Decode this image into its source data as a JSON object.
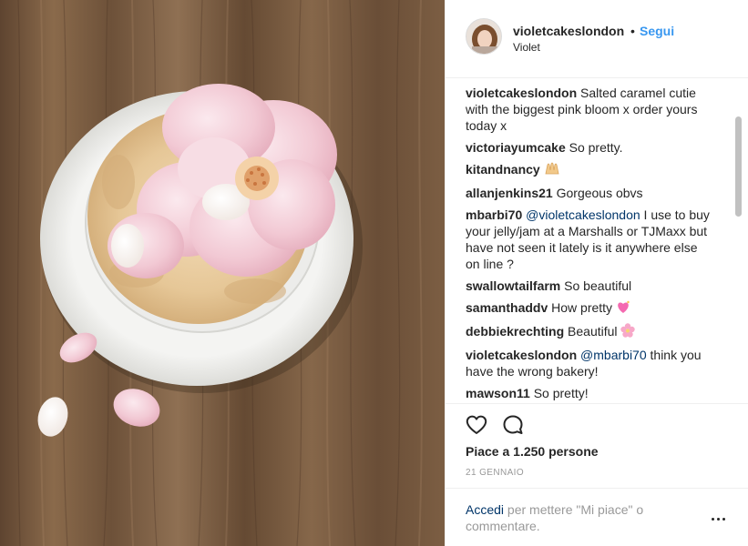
{
  "post": {
    "author": {
      "username": "violetcakeslondon",
      "bullet": "•",
      "follow_label": "Segui",
      "full_name": "Violet",
      "avatar_icon": "avatar"
    },
    "comments": [
      {
        "author": "violetcakeslondon",
        "text": "Salted caramel cutie with the biggest pink bloom x order yours today x"
      },
      {
        "author": "victoriayumcake",
        "text": "So pretty."
      },
      {
        "author": "kitandnancy",
        "text": "",
        "emoji": "raised-hands"
      },
      {
        "author": "allanjenkins21",
        "text": "Gorgeous obvs"
      },
      {
        "author": "mbarbi70",
        "mention": "@violetcakeslondon",
        "text": "I use to buy your jelly/jam at a Marshalls or TJMaxx but have not seen it lately is it anywhere else on line ?"
      },
      {
        "author": "swallowtailfarm",
        "text": "So beautiful"
      },
      {
        "author": "samanthaddv",
        "text": "How pretty",
        "emoji": "sparkling-heart"
      },
      {
        "author": "debbiekrechting",
        "text": "Beautiful",
        "emoji": "cherry-blossom"
      },
      {
        "author": "violetcakeslondon",
        "mention": "@mbarbi70",
        "text": "think you have the wrong bakery!"
      },
      {
        "author": "mawson11",
        "text": "So pretty!"
      }
    ],
    "likes_label": "Piace a 1.250 persone",
    "date_label": "21 GENNAIO",
    "login_link": "Accedi",
    "login_rest": "per mettere \"Mi piace\" o commentare.",
    "icons": {
      "like": "heart-outline-icon",
      "comment": "comment-bubble-icon",
      "more": "more-options-icon"
    },
    "colors": {
      "link": "#3897f0",
      "mention": "#003569",
      "muted": "#999999",
      "text": "#262626"
    }
  }
}
